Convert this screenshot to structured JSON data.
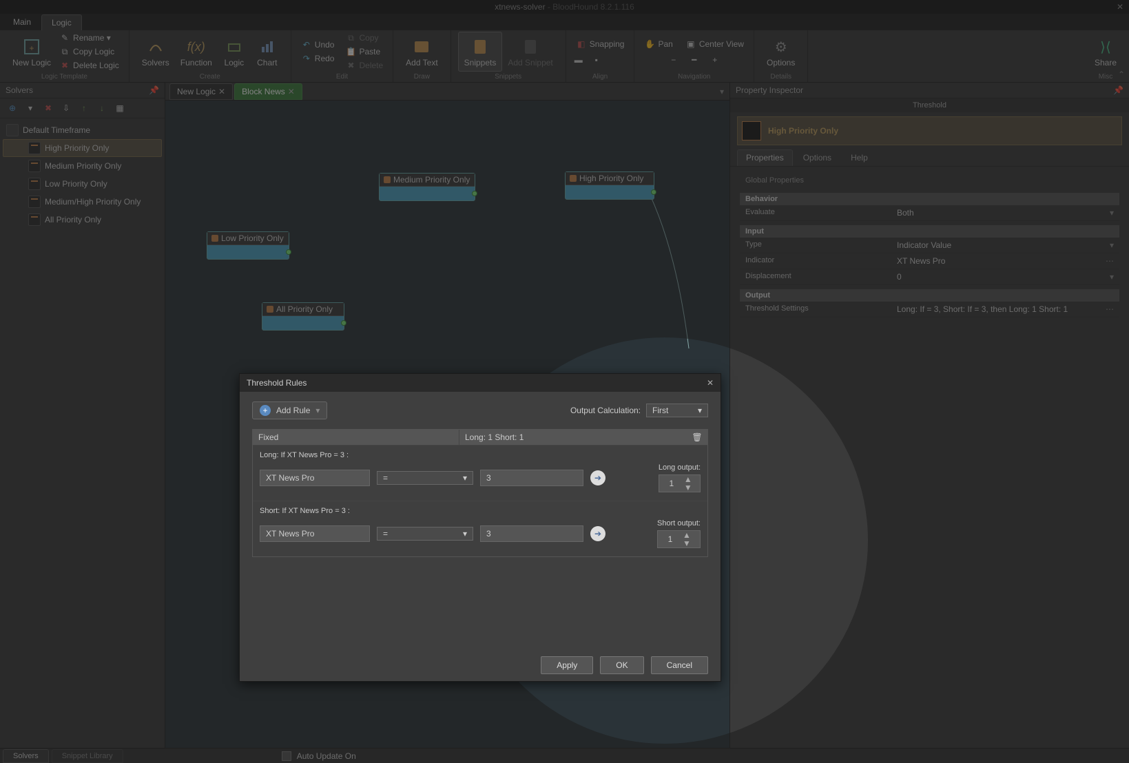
{
  "title": {
    "app": "xtnews-solver",
    "suffix": " - BloodHound 8.2.1.116"
  },
  "menu": {
    "main": "Main",
    "logic": "Logic"
  },
  "ribbon": {
    "new_logic": "New Logic",
    "rename": "Rename ▾",
    "copy_logic": "Copy Logic",
    "delete_logic": "Delete Logic",
    "solvers": "Solvers",
    "function": "Function",
    "logic": "Logic",
    "chart": "Chart",
    "undo": "Undo",
    "redo": "Redo",
    "copy": "Copy",
    "paste": "Paste",
    "delete": "Delete",
    "add_text": "Add Text",
    "snippets": "Snippets",
    "add_snippet": "Add Snippet",
    "snapping": "Snapping",
    "pan": "Pan",
    "center_view": "Center View",
    "options": "Options",
    "share": "Share",
    "groups": {
      "template": "Logic Template",
      "create": "Create",
      "edit": "Edit",
      "draw": "Draw",
      "gsnippets": "Snippets",
      "align": "Align",
      "nav": "Navigation",
      "details": "Details",
      "misc": "Misc"
    }
  },
  "solvers_panel": {
    "title": "Solvers",
    "default_tf": "Default Timeframe",
    "items": [
      "High Priority Only",
      "Medium Priority Only",
      "Low Priority Only",
      "Medium/High Priority Only",
      "All Priority Only"
    ]
  },
  "tabs": {
    "new_logic": "New Logic",
    "block_news": "Block News"
  },
  "nodes": {
    "low": "Low Priority Only",
    "medium": "Medium Priority Only",
    "high": "High Priority Only",
    "all": "All Priority Only"
  },
  "inspector": {
    "title": "Property Inspector",
    "sub": "Threshold",
    "name": "High Priority Only",
    "tabs": {
      "props": "Properties",
      "options": "Options",
      "help": "Help"
    },
    "global": "Global Properties",
    "behavior": "Behavior",
    "evaluate_k": "Evaluate",
    "evaluate_v": "Both",
    "input": "Input",
    "type_k": "Type",
    "type_v": "Indicator Value",
    "indicator_k": "Indicator",
    "indicator_v": "XT News Pro",
    "disp_k": "Displacement",
    "disp_v": "0",
    "output": "Output",
    "thresh_k": "Threshold Settings",
    "thresh_v": "Long: If  = 3, Short: If  = 3, then Long: 1 Short: 1"
  },
  "dialog": {
    "title": "Threshold Rules",
    "add_rule": "Add Rule",
    "out_calc_lbl": "Output Calculation:",
    "out_calc_v": "First",
    "col_fixed": "Fixed",
    "col_summary": "Long: 1 Short: 1",
    "long_lbl": "Long: If XT News Pro = 3 :",
    "short_lbl": "Short: If XT News Pro = 3 :",
    "ind": "XT News Pro",
    "op": "=",
    "val": "3",
    "long_out_lbl": "Long output:",
    "short_out_lbl": "Short output:",
    "long_out": "1",
    "short_out": "1",
    "apply": "Apply",
    "ok": "OK",
    "cancel": "Cancel"
  },
  "status": {
    "solvers": "Solvers",
    "snip": "Snippet Library",
    "auto": "Auto Update On"
  }
}
